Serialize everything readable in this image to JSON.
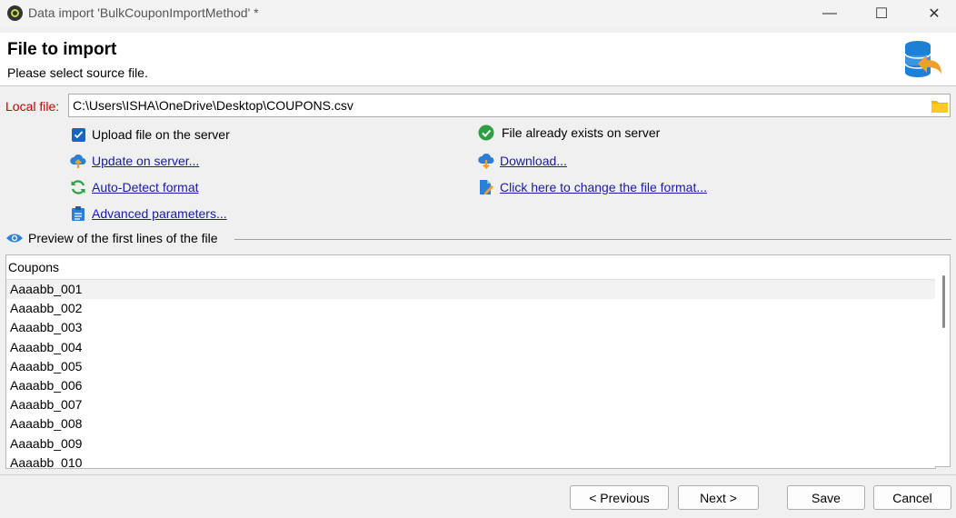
{
  "window": {
    "title": "Data import 'BulkCouponImportMethod' *",
    "minimize": "—",
    "maximize": "☐",
    "close": "✕"
  },
  "header": {
    "title": "File to import",
    "subtitle": "Please select source file."
  },
  "local_file": {
    "label": "Local file:",
    "value": "C:\\Users\\ISHA\\OneDrive\\Desktop\\COUPONS.csv"
  },
  "options": {
    "upload_checkbox_label": "Upload file on the server",
    "upload_checked": true,
    "file_exists_status": "File already exists on server",
    "update_link": "Update on server...",
    "download_link": "Download...",
    "autodetect_link": "Auto-Detect format",
    "change_format_link": "Click here to change the file format...",
    "advanced_link": "Advanced parameters..."
  },
  "preview": {
    "legend": "Preview of the first lines of the file",
    "column": "Coupons",
    "rows": [
      "Aaaabb_001",
      "Aaaabb_002",
      "Aaaabb_003",
      "Aaaabb_004",
      "Aaaabb_005",
      "Aaaabb_006",
      "Aaaabb_007",
      "Aaaabb_008",
      "Aaaabb_009",
      "Aaaabb_010"
    ],
    "selected_row": 0
  },
  "buttons": {
    "previous": "< Previous",
    "next": "Next >",
    "save": "Save",
    "cancel": "Cancel"
  },
  "colors": {
    "required_label": "#c00000",
    "link": "#1a1aa6",
    "checkbox": "#1a63c4",
    "success": "#2ea043"
  }
}
